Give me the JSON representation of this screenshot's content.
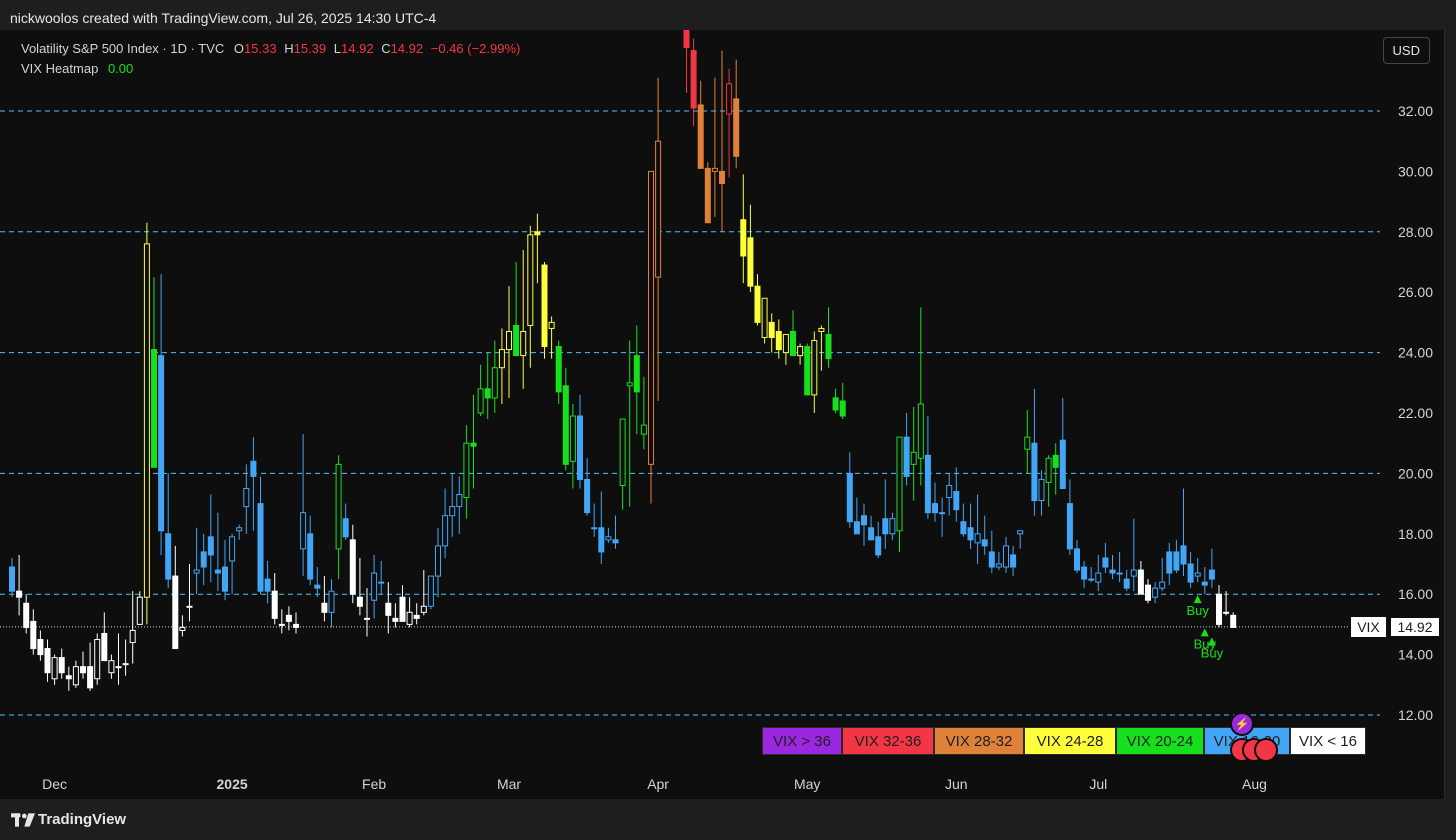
{
  "attribution": "nickwoolos created with TradingView.com, Jul 26, 2025 14:30 UTC-4",
  "legend": {
    "symbol": "Volatility S&P 500 Index · 1D · TVC",
    "o_label": "O",
    "o": "15.33",
    "h_label": "H",
    "h": "15.39",
    "l_label": "L",
    "l": "14.92",
    "c_label": "C",
    "c": "14.92",
    "change": "−0.46 (−2.99%)",
    "indicator_name": "VIX Heatmap",
    "indicator_value": "0.00"
  },
  "currency_button": "USD",
  "price_tag": {
    "symbol": "VIX",
    "value": "14.92"
  },
  "footer_brand": "TradingView",
  "heatmap_legend": [
    {
      "label": "VIX > 36",
      "color": "#9c27e0",
      "text_color": "#1e1e1e"
    },
    {
      "label": "VIX 32-36",
      "color": "#f23645",
      "text_color": "#1e1e1e"
    },
    {
      "label": "VIX 28-32",
      "color": "#e0813a",
      "text_color": "#1e1e1e"
    },
    {
      "label": "VIX 24-28",
      "color": "#ffff3b",
      "text_color": "#1e1e1e"
    },
    {
      "label": "VIX 20-24",
      "color": "#16e01b",
      "text_color": "#1e1e1e"
    },
    {
      "label": "VIX 16-20",
      "color": "#42a5f5",
      "text_color": "#1e1e1e"
    },
    {
      "label": "VIX < 16",
      "color": "#ffffff",
      "text_color": "#1e1e1e"
    }
  ],
  "colors": {
    "up_body": "#0e0e0e",
    "grid_dashed": "#4fc3f7",
    "axis_text": "#d1d4dc",
    "buy_signal": "#16e01b",
    "last_price_line": "#d1d4dc",
    "legend_red": "#f23645",
    "indicator_green": "#16e01b"
  },
  "chart_data": {
    "type": "candlestick",
    "title": "Volatility S&P 500 Index · 1D · TVC",
    "ylim": [
      11,
      35
    ],
    "y_ticks": [
      12,
      14,
      16,
      18,
      20,
      22,
      24,
      26,
      28,
      30,
      32
    ],
    "y_tick_labels": [
      "12.00",
      "14.00",
      "16.00",
      "18.00",
      "20.00",
      "22.00",
      "24.00",
      "26.00",
      "28.00",
      "30.00",
      "32.00"
    ],
    "dashed_levels": [
      12,
      16,
      20,
      24,
      28,
      32
    ],
    "x_tick_labels": [
      {
        "label": "Dec",
        "bar": 6,
        "bold": false
      },
      {
        "label": "2025",
        "bar": 31,
        "bold": true
      },
      {
        "label": "Feb",
        "bar": 51,
        "bold": false
      },
      {
        "label": "Mar",
        "bar": 70,
        "bold": false
      },
      {
        "label": "Apr",
        "bar": 91,
        "bold": false
      },
      {
        "label": "May",
        "bar": 112,
        "bold": false
      },
      {
        "label": "Jun",
        "bar": 133,
        "bold": false
      },
      {
        "label": "Jul",
        "bar": 153,
        "bold": false
      },
      {
        "label": "Aug",
        "bar": 175,
        "bold": false
      }
    ],
    "last_price": 14.92,
    "buy_signals": [
      {
        "bar": 167,
        "price": 16.1,
        "label": "Buy"
      },
      {
        "bar": 168,
        "price": 15.0,
        "label": "Buy"
      },
      {
        "bar": 169,
        "price": 14.7,
        "label": "Buy"
      }
    ],
    "candles": [
      [
        16.9,
        17.2,
        15.9,
        16.1
      ],
      [
        16.1,
        17.3,
        15.3,
        15.9
      ],
      [
        15.7,
        16.0,
        14.7,
        14.9
      ],
      [
        15.1,
        15.5,
        14.0,
        14.2
      ],
      [
        14.5,
        14.8,
        13.8,
        14.0
      ],
      [
        14.2,
        14.5,
        13.1,
        13.4
      ],
      [
        13.2,
        14.0,
        13.0,
        13.9
      ],
      [
        13.9,
        14.2,
        13.2,
        13.4
      ],
      [
        13.3,
        13.6,
        12.8,
        13.2
      ],
      [
        13.0,
        13.8,
        12.9,
        13.6
      ],
      [
        13.6,
        14.1,
        13.2,
        13.4
      ],
      [
        13.6,
        14.4,
        12.8,
        12.9
      ],
      [
        13.2,
        14.7,
        13.0,
        14.5
      ],
      [
        14.7,
        15.4,
        13.8,
        13.8
      ],
      [
        13.4,
        14.0,
        13.2,
        13.8
      ],
      [
        13.6,
        14.7,
        13.0,
        13.6
      ],
      [
        13.7,
        14.5,
        13.3,
        13.7
      ],
      [
        14.4,
        16.1,
        13.7,
        14.8
      ],
      [
        15.0,
        16.1,
        15.0,
        15.9
      ],
      [
        15.9,
        28.3,
        15.0,
        27.6
      ],
      [
        24.1,
        26.5,
        20.4,
        20.2
      ],
      [
        23.9,
        26.6,
        17.3,
        18.1
      ],
      [
        18.0,
        20.0,
        16.2,
        16.5
      ],
      [
        16.6,
        17.6,
        14.2,
        14.2
      ],
      [
        14.8,
        15.3,
        14.6,
        14.9
      ],
      [
        15.6,
        17.0,
        15.1,
        15.6
      ],
      [
        16.7,
        18.2,
        16.0,
        16.8
      ],
      [
        17.4,
        18.0,
        16.3,
        16.9
      ],
      [
        17.9,
        19.3,
        16.4,
        17.3
      ],
      [
        16.8,
        18.7,
        16.1,
        16.7
      ],
      [
        16.9,
        17.8,
        15.8,
        16.1
      ],
      [
        17.1,
        18.0,
        16.0,
        17.9
      ],
      [
        18.1,
        18.3,
        17.8,
        18.2
      ],
      [
        18.9,
        20.3,
        18.0,
        19.5
      ],
      [
        20.4,
        21.2,
        18.1,
        19.9
      ],
      [
        19.0,
        19.9,
        16.0,
        16.1
      ],
      [
        16.5,
        17.1,
        15.7,
        16.1
      ],
      [
        16.1,
        16.7,
        15.0,
        15.2
      ],
      [
        15.0,
        15.5,
        14.7,
        15.0
      ],
      [
        15.3,
        15.6,
        14.8,
        15.1
      ],
      [
        15.0,
        15.4,
        14.7,
        14.9
      ],
      [
        17.5,
        21.3,
        16.6,
        18.7
      ],
      [
        18.0,
        18.6,
        16.3,
        16.5
      ],
      [
        16.3,
        16.9,
        15.9,
        16.2
      ],
      [
        15.7,
        16.6,
        15.1,
        15.4
      ],
      [
        15.4,
        16.5,
        14.9,
        16.1
      ],
      [
        17.5,
        20.6,
        16.5,
        20.3
      ],
      [
        18.5,
        19.0,
        17.8,
        17.9
      ],
      [
        17.8,
        18.3,
        15.7,
        16.0
      ],
      [
        15.9,
        17.2,
        15.3,
        15.6
      ],
      [
        15.2,
        16.2,
        14.6,
        15.2
      ],
      [
        15.8,
        17.3,
        15.2,
        16.7
      ],
      [
        16.4,
        17.1,
        16.0,
        16.4
      ],
      [
        15.7,
        16.4,
        14.7,
        15.3
      ],
      [
        15.2,
        15.7,
        14.9,
        15.1
      ],
      [
        15.9,
        16.3,
        15.1,
        15.1
      ],
      [
        15.0,
        15.9,
        14.9,
        15.4
      ],
      [
        15.3,
        15.7,
        15.0,
        15.2
      ],
      [
        15.4,
        16.8,
        15.3,
        15.6
      ],
      [
        15.6,
        16.6,
        15.5,
        16.6
      ],
      [
        16.6,
        18.2,
        15.9,
        17.6
      ],
      [
        17.6,
        19.5,
        17.2,
        18.6
      ],
      [
        18.6,
        20.0,
        17.9,
        18.9
      ],
      [
        18.9,
        19.9,
        18.0,
        19.3
      ],
      [
        19.2,
        21.6,
        18.5,
        21.0
      ],
      [
        21.0,
        22.6,
        19.5,
        20.9
      ],
      [
        22.0,
        23.6,
        21.9,
        22.8
      ],
      [
        22.8,
        24.0,
        21.8,
        22.5
      ],
      [
        22.5,
        24.4,
        22.0,
        23.5
      ],
      [
        23.5,
        24.8,
        22.3,
        24.1
      ],
      [
        24.1,
        26.2,
        22.5,
        24.7
      ],
      [
        24.9,
        27.0,
        23.9,
        23.9
      ],
      [
        23.9,
        27.4,
        22.8,
        24.7
      ],
      [
        24.9,
        28.2,
        23.5,
        27.9
      ],
      [
        28.0,
        28.6,
        26.3,
        27.9
      ],
      [
        26.9,
        27.0,
        23.8,
        24.2
      ],
      [
        24.8,
        25.2,
        23.8,
        25.0
      ],
      [
        24.2,
        24.4,
        22.3,
        22.7
      ],
      [
        22.9,
        23.5,
        20.1,
        20.3
      ],
      [
        20.4,
        22.3,
        19.5,
        21.9
      ],
      [
        21.9,
        22.6,
        19.5,
        19.8
      ],
      [
        19.8,
        20.5,
        18.6,
        18.7
      ],
      [
        18.2,
        19.0,
        17.9,
        18.2
      ],
      [
        18.2,
        19.4,
        17.0,
        17.4
      ],
      [
        17.8,
        18.2,
        17.7,
        17.9
      ],
      [
        17.8,
        18.6,
        17.5,
        17.7
      ],
      [
        19.6,
        21.3,
        18.8,
        21.8
      ],
      [
        22.9,
        24.4,
        18.9,
        23.0
      ],
      [
        23.9,
        24.9,
        21.3,
        22.7
      ],
      [
        21.3,
        23.2,
        20.8,
        21.6
      ],
      [
        20.3,
        24.2,
        19.0,
        30.0
      ],
      [
        26.5,
        33.1,
        22.4,
        31.0
      ],
      [
        45.0,
        60.1,
        38.6,
        46.9
      ],
      [
        47.0,
        52.4,
        38.0,
        50.0
      ],
      [
        40.0,
        42.6,
        36.9,
        37.8
      ],
      [
        37.8,
        39.1,
        32.6,
        34.1
      ],
      [
        34.0,
        34.4,
        31.5,
        32.1
      ],
      [
        32.2,
        33.0,
        30.1,
        30.1
      ],
      [
        30.1,
        30.3,
        28.3,
        28.3
      ],
      [
        30.0,
        33.1,
        28.5,
        30.1
      ],
      [
        30.0,
        34.0,
        28.0,
        29.6
      ],
      [
        31.9,
        33.4,
        29.8,
        32.9
      ],
      [
        32.4,
        33.7,
        30.1,
        30.5
      ],
      [
        28.4,
        29.9,
        26.3,
        27.2
      ],
      [
        27.8,
        28.9,
        26.0,
        26.2
      ],
      [
        26.2,
        26.6,
        24.9,
        25.0
      ],
      [
        24.5,
        25.0,
        24.3,
        25.8
      ],
      [
        25.0,
        25.3,
        24.0,
        24.5
      ],
      [
        24.7,
        25.1,
        23.8,
        24.1
      ],
      [
        24.0,
        24.6,
        23.6,
        24.6
      ],
      [
        24.7,
        25.4,
        23.9,
        23.9
      ],
      [
        23.9,
        24.3,
        23.6,
        24.2
      ],
      [
        24.2,
        24.3,
        22.7,
        22.6
      ],
      [
        22.6,
        24.7,
        22.0,
        24.4
      ],
      [
        24.7,
        24.9,
        23.4,
        24.8
      ],
      [
        24.6,
        25.5,
        23.5,
        23.8
      ],
      [
        22.5,
        22.8,
        22.0,
        22.1
      ],
      [
        22.4,
        23.0,
        21.8,
        21.9
      ],
      [
        20.0,
        20.7,
        18.2,
        18.4
      ],
      [
        18.4,
        19.2,
        18.0,
        18.0
      ],
      [
        18.6,
        19.0,
        17.6,
        18.3
      ],
      [
        18.2,
        18.6,
        17.8,
        17.8
      ],
      [
        17.9,
        18.4,
        17.2,
        17.3
      ],
      [
        18.5,
        19.8,
        17.5,
        18.0
      ],
      [
        18.0,
        18.7,
        17.8,
        18.5
      ],
      [
        18.1,
        21.2,
        17.4,
        21.2
      ],
      [
        21.2,
        22.0,
        19.6,
        19.9
      ],
      [
        20.3,
        22.2,
        19.1,
        20.7
      ],
      [
        20.5,
        25.5,
        19.6,
        22.3
      ],
      [
        20.6,
        21.9,
        18.5,
        18.7
      ],
      [
        19.0,
        19.7,
        18.4,
        18.7
      ],
      [
        18.7,
        19.2,
        17.9,
        18.7
      ],
      [
        19.2,
        20.0,
        18.6,
        19.6
      ],
      [
        19.4,
        20.2,
        18.4,
        18.8
      ],
      [
        18.4,
        19.0,
        17.9,
        18.0
      ],
      [
        18.2,
        19.0,
        17.5,
        17.8
      ],
      [
        17.7,
        19.3,
        17.0,
        18.0
      ],
      [
        17.8,
        18.6,
        17.3,
        17.6
      ],
      [
        17.4,
        18.1,
        16.7,
        16.9
      ],
      [
        16.9,
        17.4,
        16.8,
        17.0
      ],
      [
        16.9,
        17.9,
        16.7,
        17.6
      ],
      [
        17.3,
        17.6,
        16.6,
        16.9
      ],
      [
        18.0,
        18.1,
        17.5,
        18.1
      ],
      [
        20.8,
        22.1,
        20.0,
        21.2
      ],
      [
        21.0,
        22.8,
        18.6,
        19.1
      ],
      [
        19.1,
        20.1,
        18.6,
        19.8
      ],
      [
        19.7,
        20.6,
        18.9,
        20.5
      ],
      [
        20.6,
        21.0,
        19.3,
        20.2
      ],
      [
        21.1,
        22.5,
        19.5,
        19.5
      ],
      [
        19.0,
        19.8,
        17.3,
        17.5
      ],
      [
        17.5,
        17.8,
        16.7,
        16.8
      ],
      [
        16.9,
        17.1,
        16.2,
        16.5
      ],
      [
        16.5,
        16.9,
        16.4,
        16.5
      ],
      [
        16.4,
        17.3,
        16.1,
        16.7
      ],
      [
        17.2,
        17.7,
        16.7,
        16.9
      ],
      [
        16.8,
        17.3,
        16.5,
        16.7
      ],
      [
        16.7,
        17.4,
        16.4,
        16.7
      ],
      [
        16.5,
        16.8,
        16.1,
        16.2
      ],
      [
        16.6,
        18.5,
        16.1,
        16.8
      ],
      [
        16.8,
        17.1,
        16.0,
        16.0
      ],
      [
        16.3,
        16.5,
        15.7,
        15.8
      ],
      [
        15.9,
        16.4,
        15.7,
        16.2
      ],
      [
        16.2,
        17.2,
        16.1,
        16.4
      ],
      [
        17.4,
        17.7,
        16.3,
        16.7
      ],
      [
        17.4,
        17.8,
        16.7,
        16.8
      ],
      [
        17.6,
        19.5,
        16.6,
        17.0
      ],
      [
        17.0,
        17.4,
        16.2,
        16.4
      ],
      [
        16.6,
        17.2,
        16.4,
        16.7
      ],
      [
        16.4,
        16.9,
        16.0,
        16.3
      ],
      [
        16.8,
        17.5,
        16.2,
        16.5
      ],
      [
        16.0,
        16.3,
        14.9,
        15.0
      ],
      [
        15.4,
        16.1,
        15.3,
        15.4
      ],
      [
        15.3,
        15.4,
        14.9,
        14.9
      ]
    ]
  }
}
